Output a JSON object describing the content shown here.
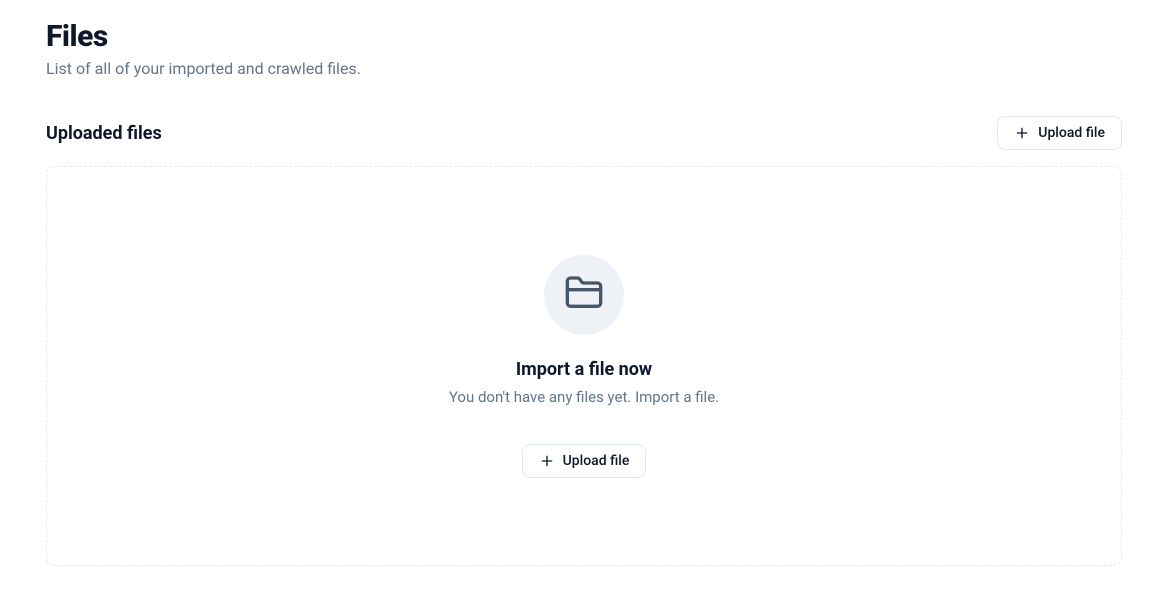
{
  "header": {
    "title": "Files",
    "subtitle": "List of all of your imported and crawled files."
  },
  "section": {
    "title": "Uploaded files",
    "upload_button_label": "Upload file"
  },
  "empty_state": {
    "title": "Import a file now",
    "description": "You don't have any files yet. Import a file.",
    "upload_button_label": "Upload file"
  }
}
